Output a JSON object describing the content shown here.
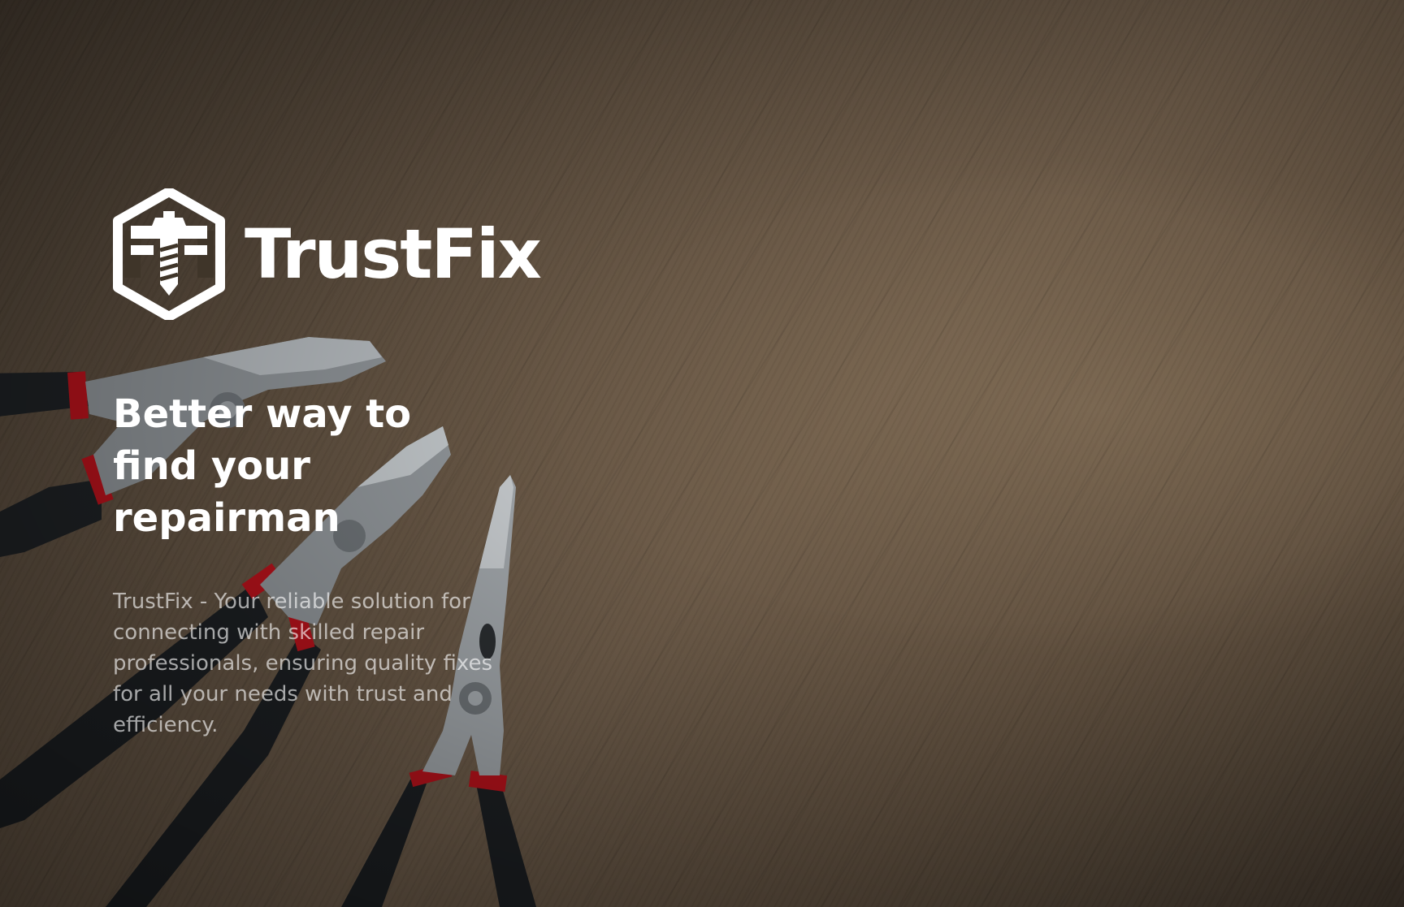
{
  "brand": {
    "name": "TrustFix",
    "logo_icon": "hexagon-screw-icon"
  },
  "hero": {
    "headline": "Better way to find your repairman",
    "description": "TrustFix - Your reliable solution for connecting with skilled repair professionals, ensuring quality fixes for all your needs with trust and efficiency."
  },
  "background": {
    "image": "pliers-on-wooden-table",
    "overlay_color": "#000000"
  }
}
